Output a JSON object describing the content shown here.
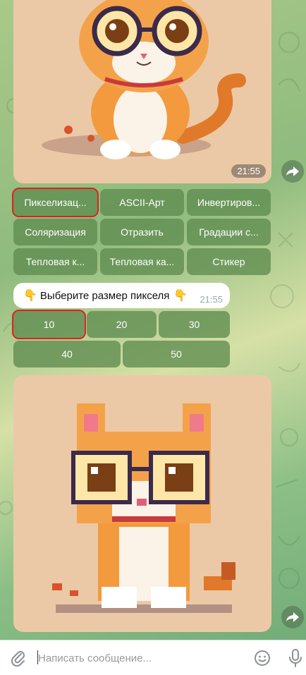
{
  "messages": {
    "first_image_time": "21:55",
    "prompt_text": "Выберите размер пикселя",
    "prompt_emoji_left": "👇",
    "prompt_emoji_right": "👇",
    "prompt_time": "21:55"
  },
  "effect_keyboard": {
    "buttons": [
      {
        "label": "Пикселизац...",
        "highlighted": true
      },
      {
        "label": "ASCII-Арт"
      },
      {
        "label": "Инвертиров..."
      },
      {
        "label": "Соляризация"
      },
      {
        "label": "Отразить"
      },
      {
        "label": "Градации с..."
      },
      {
        "label": "Тепловая к..."
      },
      {
        "label": "Тепловая ка..."
      },
      {
        "label": "Стикер"
      }
    ]
  },
  "size_keyboard": {
    "buttons": [
      {
        "label": "10",
        "highlighted": true
      },
      {
        "label": "20"
      },
      {
        "label": "30"
      },
      {
        "label": "40"
      },
      {
        "label": "50"
      }
    ]
  },
  "composer": {
    "placeholder": "Написать сообщение..."
  },
  "icons": {
    "forward": "forward-arrow-icon",
    "attach": "paperclip-icon",
    "emoji": "smiley-icon",
    "voice": "microphone-icon"
  },
  "colors": {
    "highlight": "#e02020",
    "keyboard_button": "#5f8c50"
  }
}
